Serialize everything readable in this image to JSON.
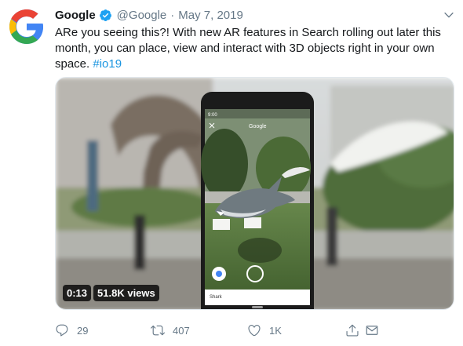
{
  "tweet": {
    "author_name": "Google",
    "handle": "@Google",
    "separator": "·",
    "date": "May 7, 2019",
    "text_main": "ARe you seeing this?! With new AR features in Search rolling out later this month, you can place, view and interact with 3D objects right in your own space. ",
    "hashtag": "#io19"
  },
  "media": {
    "phone_app_title": "Google",
    "phone_status_time": "9:00",
    "phone_card_label": "Shark",
    "video_time": "0:13",
    "video_views": "51.8K views"
  },
  "actions": {
    "reply_count": "29",
    "retweet_count": "407",
    "like_count": "1K"
  },
  "icons": [
    "google-logo",
    "verified-badge-icon",
    "chevron-down-icon",
    "reply-icon",
    "retweet-icon",
    "like-icon",
    "share-icon"
  ],
  "colors": {
    "link": "#1b95e0",
    "muted": "#657786",
    "verified": "#1da1f2"
  }
}
